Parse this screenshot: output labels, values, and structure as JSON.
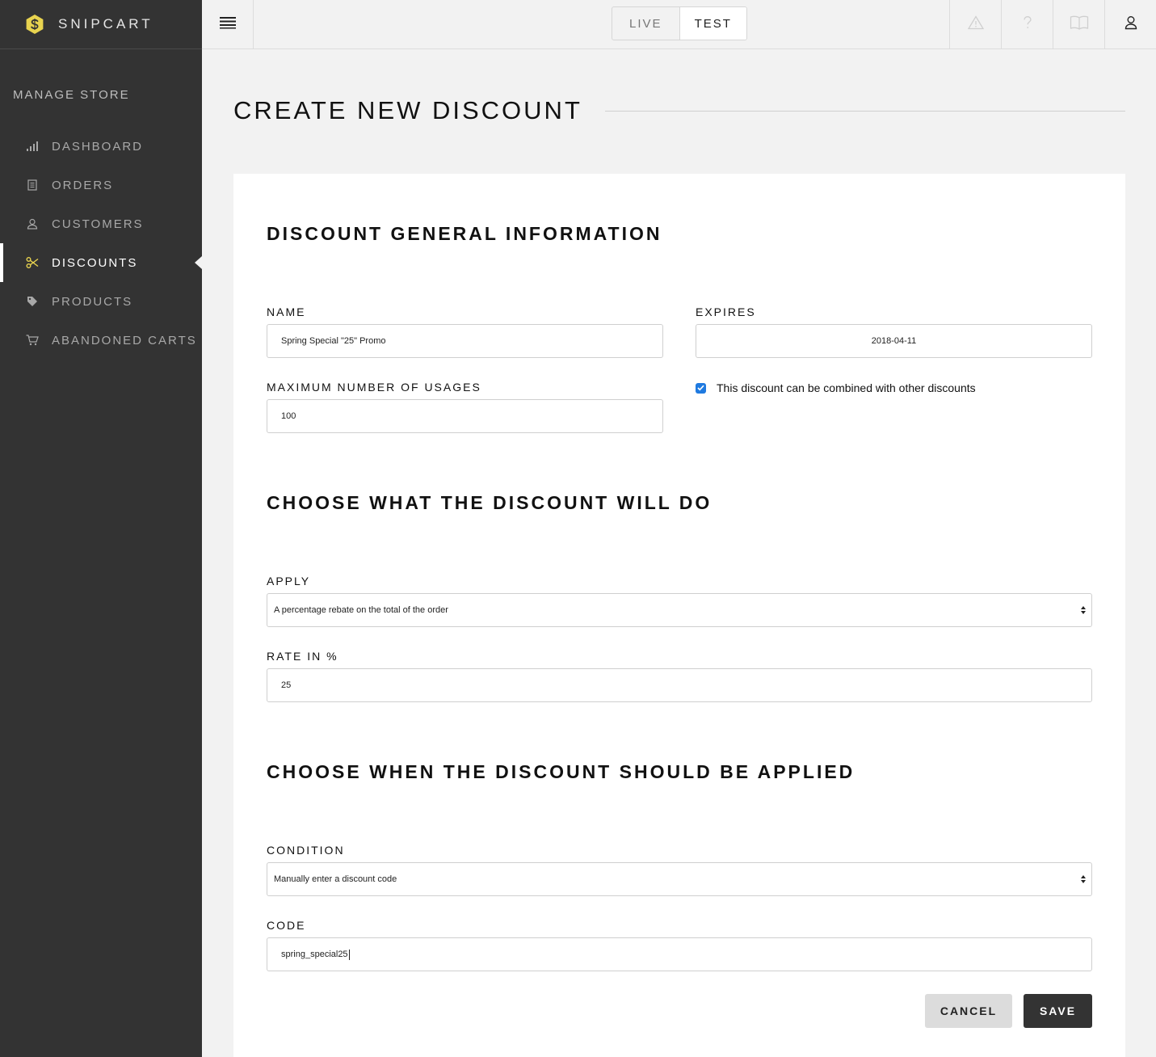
{
  "brand": {
    "name": "SNIPCART",
    "accent": "#e8d34f"
  },
  "sidebar": {
    "section_title": "MANAGE STORE",
    "items": [
      {
        "label": "DASHBOARD",
        "icon": "bar-chart-icon"
      },
      {
        "label": "ORDERS",
        "icon": "receipt-icon"
      },
      {
        "label": "CUSTOMERS",
        "icon": "user-icon"
      },
      {
        "label": "DISCOUNTS",
        "icon": "scissors-icon",
        "active": true
      },
      {
        "label": "PRODUCTS",
        "icon": "tag-icon"
      },
      {
        "label": "ABANDONED CARTS",
        "icon": "cart-icon"
      }
    ]
  },
  "topbar": {
    "env": {
      "live": "LIVE",
      "test": "TEST",
      "selected": "TEST"
    },
    "icons": [
      "warning-icon",
      "help-icon",
      "docs-book-icon",
      "account-icon"
    ]
  },
  "page": {
    "title": "CREATE NEW DISCOUNT"
  },
  "form": {
    "general": {
      "heading": "DISCOUNT GENERAL INFORMATION",
      "name_label": "NAME",
      "name_value": "Spring Special \"25\" Promo",
      "expires_label": "EXPIRES",
      "expires_value": "2018-04-11",
      "max_usages_label": "MAXIMUM NUMBER OF USAGES",
      "max_usages_value": "100",
      "combine_label": "This discount can be combined with other discounts",
      "combine_checked": true
    },
    "action": {
      "heading": "CHOOSE WHAT THE DISCOUNT WILL DO",
      "apply_label": "APPLY",
      "apply_value": "A percentage rebate on the total of the order",
      "rate_label": "RATE IN %",
      "rate_value": "25"
    },
    "condition": {
      "heading": "CHOOSE WHEN THE DISCOUNT SHOULD BE APPLIED",
      "condition_label": "CONDITION",
      "condition_value": "Manually enter a discount code",
      "code_label": "CODE",
      "code_value": "spring_special25"
    },
    "buttons": {
      "cancel": "CANCEL",
      "save": "SAVE"
    }
  }
}
